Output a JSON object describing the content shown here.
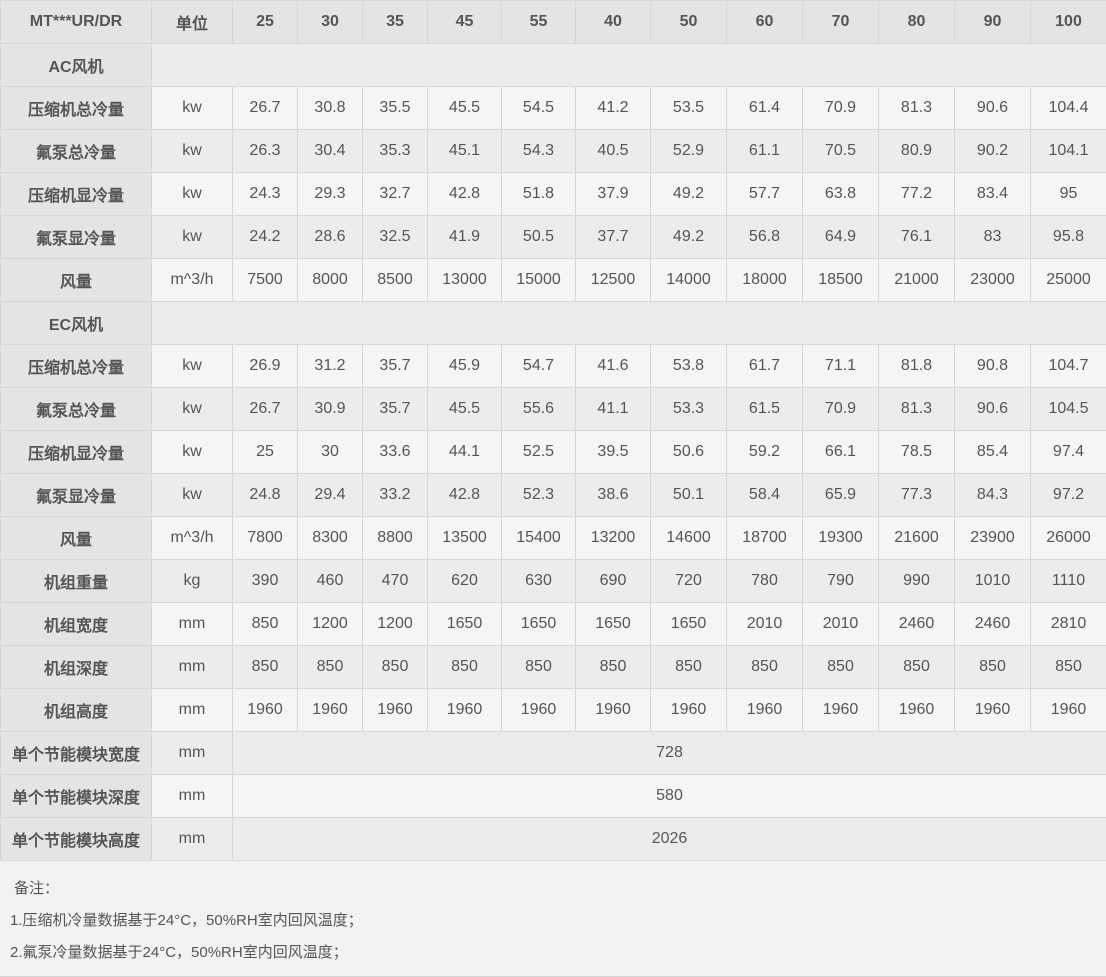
{
  "table": {
    "model_label": "MT***UR/DR",
    "unit_label": "单位",
    "models": [
      "25",
      "30",
      "35",
      "45",
      "55",
      "40",
      "50",
      "60",
      "70",
      "80",
      "90",
      "100"
    ],
    "sections": [
      {
        "title": "AC风机",
        "rows": [
          {
            "label": "压缩机总冷量",
            "unit": "kw",
            "values": [
              "26.7",
              "30.8",
              "35.5",
              "45.5",
              "54.5",
              "41.2",
              "53.5",
              "61.4",
              "70.9",
              "81.3",
              "90.6",
              "104.4"
            ]
          },
          {
            "label": "氟泵总冷量",
            "unit": "kw",
            "values": [
              "26.3",
              "30.4",
              "35.3",
              "45.1",
              "54.3",
              "40.5",
              "52.9",
              "61.1",
              "70.5",
              "80.9",
              "90.2",
              "104.1"
            ]
          },
          {
            "label": "压缩机显冷量",
            "unit": "kw",
            "values": [
              "24.3",
              "29.3",
              "32.7",
              "42.8",
              "51.8",
              "37.9",
              "49.2",
              "57.7",
              "63.8",
              "77.2",
              "83.4",
              "95"
            ]
          },
          {
            "label": "氟泵显冷量",
            "unit": "kw",
            "values": [
              "24.2",
              "28.6",
              "32.5",
              "41.9",
              "50.5",
              "37.7",
              "49.2",
              "56.8",
              "64.9",
              "76.1",
              "83",
              "95.8"
            ]
          },
          {
            "label": "风量",
            "unit": "m^3/h",
            "values": [
              "7500",
              "8000",
              "8500",
              "13000",
              "15000",
              "12500",
              "14000",
              "18000",
              "18500",
              "21000",
              "23000",
              "25000"
            ]
          }
        ]
      },
      {
        "title": "EC风机",
        "rows": [
          {
            "label": "压缩机总冷量",
            "unit": "kw",
            "values": [
              "26.9",
              "31.2",
              "35.7",
              "45.9",
              "54.7",
              "41.6",
              "53.8",
              "61.7",
              "71.1",
              "81.8",
              "90.8",
              "104.7"
            ]
          },
          {
            "label": "氟泵总冷量",
            "unit": "kw",
            "values": [
              "26.7",
              "30.9",
              "35.7",
              "45.5",
              "55.6",
              "41.1",
              "53.3",
              "61.5",
              "70.9",
              "81.3",
              "90.6",
              "104.5"
            ]
          },
          {
            "label": "压缩机显冷量",
            "unit": "kw",
            "values": [
              "25",
              "30",
              "33.6",
              "44.1",
              "52.5",
              "39.5",
              "50.6",
              "59.2",
              "66.1",
              "78.5",
              "85.4",
              "97.4"
            ]
          },
          {
            "label": "氟泵显冷量",
            "unit": "kw",
            "values": [
              "24.8",
              "29.4",
              "33.2",
              "42.8",
              "52.3",
              "38.6",
              "50.1",
              "58.4",
              "65.9",
              "77.3",
              "84.3",
              "97.2"
            ]
          },
          {
            "label": "风量",
            "unit": "m^3/h",
            "values": [
              "7800",
              "8300",
              "8800",
              "13500",
              "15400",
              "13200",
              "14600",
              "18700",
              "19300",
              "21600",
              "23900",
              "26000"
            ]
          }
        ]
      }
    ],
    "physical_rows": [
      {
        "label": "机组重量",
        "unit": "kg",
        "values": [
          "390",
          "460",
          "470",
          "620",
          "630",
          "690",
          "720",
          "780",
          "790",
          "990",
          "1010",
          "1110"
        ]
      },
      {
        "label": "机组宽度",
        "unit": "mm",
        "values": [
          "850",
          "1200",
          "1200",
          "1650",
          "1650",
          "1650",
          "1650",
          "2010",
          "2010",
          "2460",
          "2460",
          "2810"
        ]
      },
      {
        "label": "机组深度",
        "unit": "mm",
        "values": [
          "850",
          "850",
          "850",
          "850",
          "850",
          "850",
          "850",
          "850",
          "850",
          "850",
          "850",
          "850"
        ]
      },
      {
        "label": "机组高度",
        "unit": "mm",
        "values": [
          "1960",
          "1960",
          "1960",
          "1960",
          "1960",
          "1960",
          "1960",
          "1960",
          "1960",
          "1960",
          "1960",
          "1960"
        ]
      }
    ],
    "module_rows": [
      {
        "label": "单个节能模块宽度",
        "unit": "mm",
        "value": "728"
      },
      {
        "label": "单个节能模块深度",
        "unit": "mm",
        "value": "580"
      },
      {
        "label": "单个节能模块高度",
        "unit": "mm",
        "value": "2026"
      }
    ]
  },
  "notes": {
    "title": "备注：",
    "lines": [
      "1.压缩机冷量数据基于24°C，50%RH室内回风温度；",
      "2.氟泵冷量数据基于24°C，50%RH室内回风温度；"
    ]
  }
}
